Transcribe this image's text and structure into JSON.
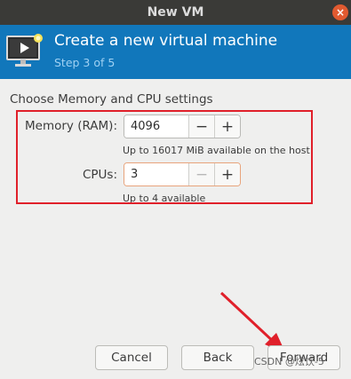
{
  "window": {
    "title": "New VM",
    "close_glyph": "×"
  },
  "header": {
    "title": "Create a new virtual machine",
    "step": "Step 3 of 5",
    "icon": "monitor-icon",
    "accent": "#1177bb"
  },
  "section_title": "Choose Memory and CPU settings",
  "memory": {
    "label": "Memory (RAM):",
    "value": "4096",
    "decrement": "−",
    "increment": "+",
    "hint": "Up to 16017 MiB available on the host"
  },
  "cpus": {
    "label": "CPUs:",
    "value": "3",
    "decrement": "−",
    "increment": "+",
    "hint": "Up to 4 available"
  },
  "buttons": {
    "cancel": "Cancel",
    "back": "Back",
    "forward": "Forward"
  },
  "annotation": {
    "color": "#e0202a"
  },
  "watermark": "CSDN @炫饮-5"
}
